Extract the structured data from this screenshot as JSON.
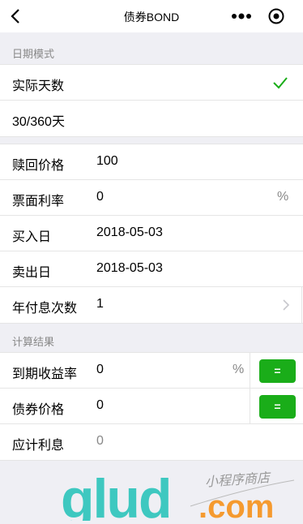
{
  "nav": {
    "title": "债券BOND"
  },
  "section_date": {
    "header": "日期模式",
    "options": [
      {
        "label": "实际天数",
        "selected": true
      },
      {
        "label": "30/360天",
        "selected": false
      }
    ]
  },
  "inputs": {
    "redemption_price": {
      "label": "赎回价格",
      "value": "100"
    },
    "coupon_rate": {
      "label": "票面利率",
      "value": "0",
      "unit": "%"
    },
    "buy_date": {
      "label": "买入日",
      "value": "2018-05-03"
    },
    "sell_date": {
      "label": "卖出日",
      "value": "2018-05-03"
    },
    "payments_per_year": {
      "label": "年付息次数",
      "value": "1"
    }
  },
  "results": {
    "header": "计算结果",
    "ytm": {
      "label": "到期收益率",
      "value": "0",
      "unit": "%",
      "button": "="
    },
    "bond_price": {
      "label": "债券价格",
      "value": "0",
      "button": "="
    },
    "accrued_interest": {
      "label": "应计利息",
      "value": "0"
    }
  },
  "watermark": {
    "text": "glud.com",
    "tagline": "小程序商店"
  },
  "colors": {
    "accent": "#1aad19",
    "watermark_teal": "#3ec8c0",
    "watermark_orange": "#f59a2f"
  }
}
